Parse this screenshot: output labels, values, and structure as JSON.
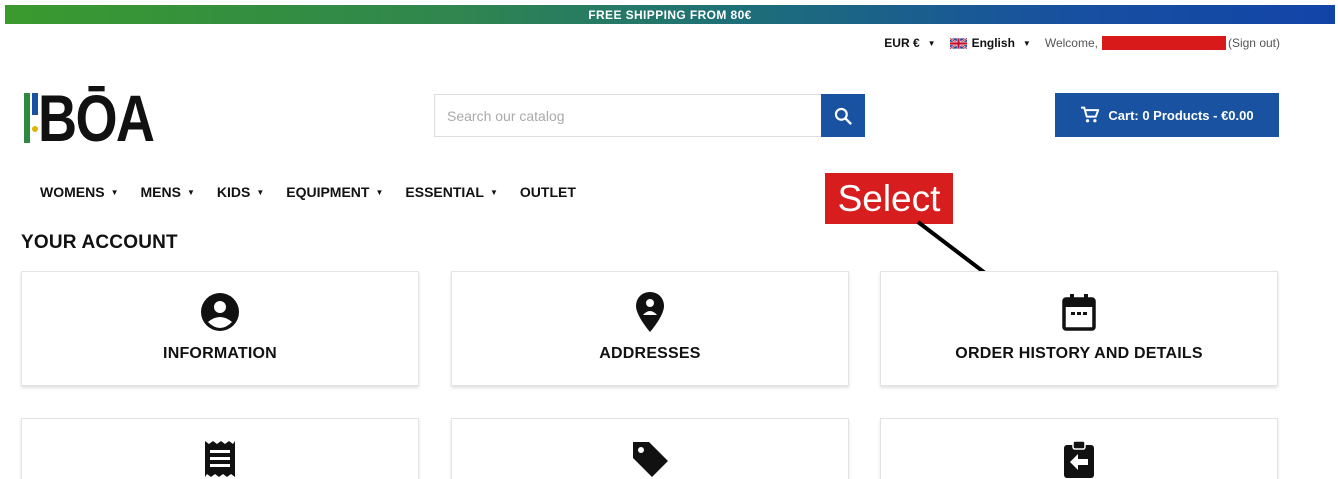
{
  "promo": {
    "text": "FREE SHIPPING FROM 80€"
  },
  "topbar": {
    "currency": "EUR €",
    "language": "English",
    "welcome": "Welcome,",
    "signout": "(Sign out)"
  },
  "logo": {
    "text": "BŌA"
  },
  "search": {
    "placeholder": "Search our catalog"
  },
  "cart": {
    "label": "Cart: 0 Products - €0.00"
  },
  "nav": {
    "items": [
      {
        "label": "WOMENS",
        "has_dropdown": true
      },
      {
        "label": "MENS",
        "has_dropdown": true
      },
      {
        "label": "KIDS",
        "has_dropdown": true
      },
      {
        "label": "EQUIPMENT",
        "has_dropdown": true
      },
      {
        "label": "ESSENTIAL",
        "has_dropdown": true
      },
      {
        "label": "OUTLET",
        "has_dropdown": false
      }
    ]
  },
  "annotation": {
    "text": "Select",
    "color": "#d71d1d"
  },
  "account": {
    "title": "YOUR ACCOUNT",
    "cards": [
      {
        "label": "INFORMATION",
        "icon": "account-circle-icon"
      },
      {
        "label": "ADDRESSES",
        "icon": "location-pin-icon"
      },
      {
        "label": "ORDER HISTORY AND DETAILS",
        "icon": "calendar-icon"
      },
      {
        "label": "",
        "icon": "receipt-icon"
      },
      {
        "label": "",
        "icon": "tag-icon"
      },
      {
        "label": "",
        "icon": "return-clipboard-icon"
      }
    ]
  },
  "colors": {
    "brand_blue": "#1852a0",
    "promo_green": "#3a9a2e"
  }
}
